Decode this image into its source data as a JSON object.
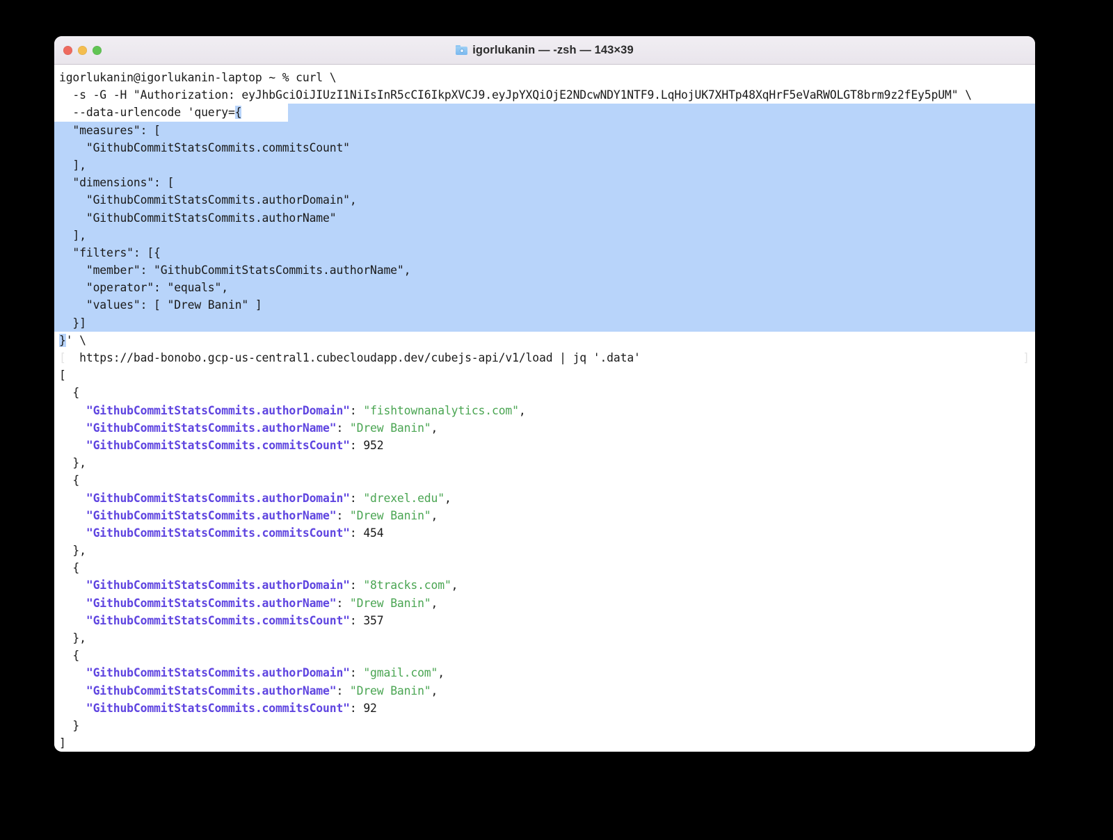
{
  "window": {
    "title": "igorlukanin — -zsh — 143×39",
    "folder_icon": "folder-icon",
    "traffic_lights": {
      "close": "close-button",
      "minimize": "minimize-button",
      "maximize": "maximize-button"
    },
    "colors": {
      "background": "#ffffff",
      "titlebar": "#ece8ef",
      "selection": "#b8d4fa",
      "jq_key": "#5f45e0",
      "jq_string": "#4aa552",
      "text": "#1a1a1a",
      "close": "#ee6a5f",
      "minimize": "#f4bd4f",
      "maximize": "#61c454"
    }
  },
  "terminal": {
    "prompt": {
      "user_host": "igorlukanin@igorlukanin-laptop",
      "path": "~",
      "symbol": "%",
      "command": "curl \\"
    },
    "command_lines": {
      "auth_header": "  -s -G -H \"Authorization: eyJhbGciOiJIUzI1NiIsInR5cCI6IkpXVCJ9.eyJpYXQiOjE2NDcwNDY1NTF9.LqHojUK7XHTp48XqHrF5eVaRWOLGT8brm9z2fEy5pUM\" \\",
      "data_urlencode_prefix": "  --data-urlencode 'query=",
      "data_urlencode_brace": "{",
      "query_body": [
        "  \"measures\": [",
        "    \"GithubCommitStatsCommits.commitsCount\"",
        "  ],",
        "  \"dimensions\": [",
        "    \"GithubCommitStatsCommits.authorDomain\",",
        "    \"GithubCommitStatsCommits.authorName\"",
        "  ],",
        "  \"filters\": [{",
        "    \"member\": \"GithubCommitStatsCommits.authorName\",",
        "    \"operator\": \"equals\",",
        "    \"values\": [ \"Drew Banin\" ]",
        "  }]"
      ],
      "close_brace_selected": "}",
      "close_brace_rest": "' \\",
      "url_line": "  https://bad-bonobo.gcp-us-central1.cubecloudapp.dev/cubejs-api/v1/load | jq '.data'",
      "left_marker": "[",
      "right_marker": "]"
    },
    "output": {
      "open_bracket": "[",
      "close_bracket": "]",
      "object_open": "  {",
      "object_close": "  }",
      "object_close_comma": "  },",
      "keys": {
        "author_domain": "\"GithubCommitStatsCommits.authorDomain\"",
        "author_name": "\"GithubCommitStatsCommits.authorName\"",
        "commits_count": "\"GithubCommitStatsCommits.commitsCount\""
      },
      "records": [
        {
          "authorDomain": "\"fishtownanalytics.com\"",
          "authorName": "\"Drew Banin\"",
          "commitsCount": "952"
        },
        {
          "authorDomain": "\"drexel.edu\"",
          "authorName": "\"Drew Banin\"",
          "commitsCount": "454"
        },
        {
          "authorDomain": "\"8tracks.com\"",
          "authorName": "\"Drew Banin\"",
          "commitsCount": "357"
        },
        {
          "authorDomain": "\"gmail.com\"",
          "authorName": "\"Drew Banin\"",
          "commitsCount": "92"
        }
      ],
      "punct": {
        "colon": ": ",
        "comma": ","
      }
    }
  }
}
